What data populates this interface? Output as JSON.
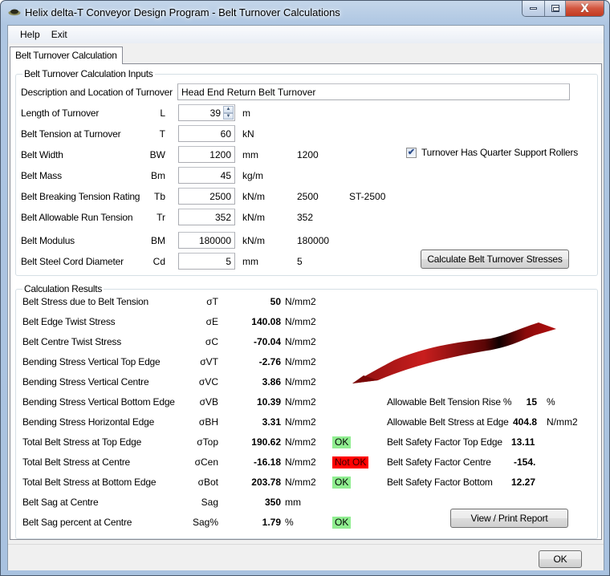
{
  "window": {
    "title": "Helix delta-T Conveyor Design Program - Belt Turnover Calculations",
    "app_icon": "helix-logo-icon",
    "controls": {
      "minimize": "minimize-icon",
      "maximize": "maximize-icon",
      "close_glyph": "X"
    }
  },
  "menu": {
    "items": [
      {
        "label": "Help"
      },
      {
        "label": "Exit"
      }
    ]
  },
  "tabs": [
    {
      "label": "Belt Turnover Calculation",
      "active": true
    }
  ],
  "inputs": {
    "group_title": "Belt Turnover Calculation Inputs",
    "description": {
      "label": "Description and Location of Turnover",
      "value": "Head End Return Belt Turnover"
    },
    "rows": [
      {
        "label": "Length of Turnover",
        "symbol": "L",
        "value": "39",
        "unit": "m",
        "ref": "",
        "extra": ""
      },
      {
        "label": "Belt Tension at Turnover",
        "symbol": "T",
        "value": "60",
        "unit": "kN",
        "ref": "",
        "extra": ""
      },
      {
        "label": "Belt Width",
        "symbol": "BW",
        "value": "1200",
        "unit": "mm",
        "ref": "1200",
        "extra": ""
      },
      {
        "label": "Belt Mass",
        "symbol": "Bm",
        "value": "45",
        "unit": "kg/m",
        "ref": "",
        "extra": ""
      },
      {
        "label": "Belt Breaking Tension Rating",
        "symbol": "Tb",
        "value": "2500",
        "unit": "kN/m",
        "ref": "2500",
        "extra": "ST-2500"
      },
      {
        "label": "Belt Allowable Run Tension",
        "symbol": "Tr",
        "value": "352",
        "unit": "kN/m",
        "ref": "352",
        "extra": ""
      },
      {
        "label": "Belt Modulus",
        "symbol": "BM",
        "value": "180000",
        "unit": "kN/m",
        "ref": "180000",
        "extra": ""
      },
      {
        "label": "Belt Steel Cord Diameter",
        "symbol": "Cd",
        "value": "5",
        "unit": "mm",
        "ref": "5",
        "extra": ""
      }
    ],
    "quarter_rollers": {
      "label": "Turnover Has Quarter Support Rollers",
      "checked": true,
      "check_glyph": "✔"
    },
    "calculate_button": "Calculate Belt Turnover Stresses",
    "spin_up": "▲",
    "spin_down": "▼"
  },
  "results": {
    "group_title": "Calculation Results",
    "rows": [
      {
        "label": "Belt Stress due to Belt Tension",
        "symbol": "σT",
        "value": "50",
        "unit": "N/mm2",
        "status": ""
      },
      {
        "label": "Belt Edge Twist Stress",
        "symbol": "σE",
        "value": "140.08",
        "unit": "N/mm2",
        "status": ""
      },
      {
        "label": "Belt Centre Twist Stress",
        "symbol": "σC",
        "value": "-70.04",
        "unit": "N/mm2",
        "status": ""
      },
      {
        "label": "Bending Stress Vertical Top Edge",
        "symbol": "σVT",
        "value": "-2.76",
        "unit": "N/mm2",
        "status": ""
      },
      {
        "label": "Bending Stress Vertical Centre",
        "symbol": "σVC",
        "value": "3.86",
        "unit": "N/mm2",
        "status": ""
      },
      {
        "label": "Bending Stress Vertical Bottom Edge",
        "symbol": "σVB",
        "value": "10.39",
        "unit": "N/mm2",
        "status": ""
      },
      {
        "label": "Bending Stress Horizontal Edge",
        "symbol": "σBH",
        "value": "3.31",
        "unit": "N/mm2",
        "status": ""
      },
      {
        "label": "Total Belt Stress at Top Edge",
        "symbol": "σTop",
        "value": "190.62",
        "unit": "N/mm2",
        "status": "OK"
      },
      {
        "label": "Total Belt Stress at Centre",
        "symbol": "σCen",
        "value": "-16.18",
        "unit": "N/mm2",
        "status": "Not OK"
      },
      {
        "label": "Total Belt Stress at Bottom Edge",
        "symbol": "σBot",
        "value": "203.78",
        "unit": "N/mm2",
        "status": "OK"
      },
      {
        "label": "Belt Sag at Centre",
        "symbol": "Sag",
        "value": "350",
        "unit": "mm",
        "status": ""
      },
      {
        "label": "Belt Sag percent at Centre",
        "symbol": "Sag%",
        "value": "1.79",
        "unit": "%",
        "status": "OK"
      }
    ],
    "side": [
      {
        "label": "Allowable Belt Tension Rise %",
        "value": "15",
        "unit": "%"
      },
      {
        "label": "Allowable Belt Stress at Edge",
        "value": "404.8",
        "unit": "N/mm2"
      },
      {
        "label": "Belt Safety Factor Top Edge",
        "value": "13.11",
        "unit": ""
      },
      {
        "label": "Belt Safety Factor Centre",
        "value": "-154.",
        "unit": ""
      },
      {
        "label": "Belt Safety Factor Bottom",
        "value": "12.27",
        "unit": ""
      }
    ],
    "status_colors": {
      "ok": "#90ee90",
      "not_ok": "#ff0000"
    },
    "belt_color": "#c81e1e",
    "report_button": "View / Print Report"
  },
  "footer": {
    "ok_button": "OK"
  }
}
